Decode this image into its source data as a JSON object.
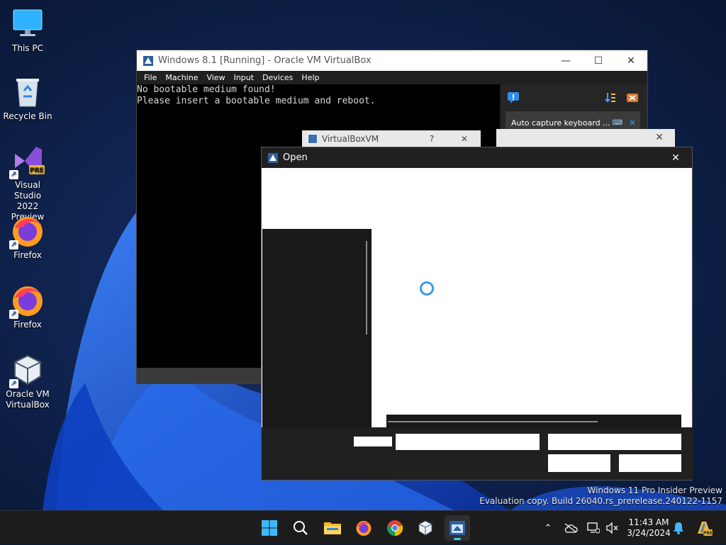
{
  "desktop": {
    "icons": [
      {
        "label": "This PC",
        "icon": "computer-monitor-icon"
      },
      {
        "label": "Recycle Bin",
        "icon": "recycle-bin-icon"
      },
      {
        "label": "Visual Studio 2022 Preview",
        "icon": "visual-studio-icon",
        "badge": "PRE"
      },
      {
        "label": "Firefox",
        "icon": "firefox-icon"
      },
      {
        "label": "Firefox",
        "icon": "firefox-icon"
      },
      {
        "label": "Oracle VM VirtualBox",
        "icon": "virtualbox-icon"
      }
    ]
  },
  "vbox": {
    "title": "Windows 8.1 [Running] - Oracle VM VirtualBox",
    "menu": [
      "File",
      "Machine",
      "View",
      "Input",
      "Devices",
      "Help"
    ],
    "screen_lines": [
      "No bootable medium found!",
      "Please insert a bootable medium and reboot."
    ],
    "notification": "Auto capture keyboard ..."
  },
  "vbox_vm": {
    "title": "VirtualBoxVM",
    "help": "?",
    "close": "✕"
  },
  "open_dialog": {
    "title": "Open",
    "close": "✕"
  },
  "taskbar": {
    "time": "11:43 AM",
    "date": "3/24/2024"
  },
  "watermark": {
    "line1": "Windows 11 Pro Insider Preview",
    "line2": "Evaluation copy. Build 26040.rs_prerelease.240122-1157"
  },
  "colors": {
    "accent": "#4cc2ff",
    "spinner": "#3d9ae8",
    "wallpaper_dark": "#0a1a3c",
    "wallpaper_blue": "#1f5ad6"
  }
}
